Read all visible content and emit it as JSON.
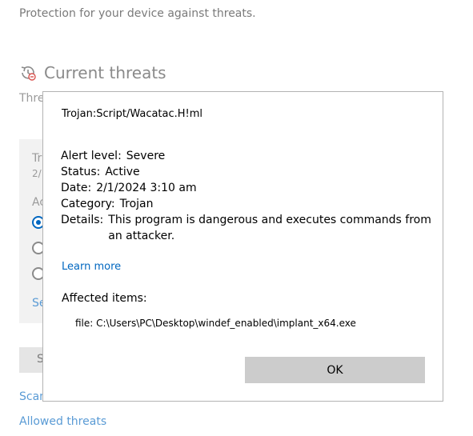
{
  "background": {
    "subtitle": "Protection for your device against threats.",
    "section_title": "Current threats",
    "section_desc_partial": "Thre",
    "card": {
      "name_partial": "Tr",
      "date_partial": "2/",
      "actions_partial": "Ac"
    },
    "see_partial": "Se",
    "start_partial": "S",
    "scan_partial": "Scan",
    "allowed_threats": "Allowed threats",
    "icon": "threat-history-icon"
  },
  "dialog": {
    "title": "Trojan:Script/Wacatac.H!ml",
    "fields": {
      "alert_level_label": "Alert level:",
      "alert_level_value": "Severe",
      "status_label": "Status:",
      "status_value": "Active",
      "date_label": "Date:",
      "date_value": "2/1/2024 3:10 am",
      "category_label": "Category:",
      "category_value": "Trojan",
      "details_label": "Details:",
      "details_value": "This program is dangerous and executes commands from an attacker."
    },
    "learn_more": "Learn more",
    "affected_label": "Affected items:",
    "file_label": "file:",
    "file_path": "C:\\Users\\PC\\Desktop\\windef_enabled\\implant_x64.exe",
    "ok_label": "OK"
  },
  "colors": {
    "link": "#0067c0",
    "muted_link": "#5a9bd5",
    "button": "#cccccc"
  }
}
